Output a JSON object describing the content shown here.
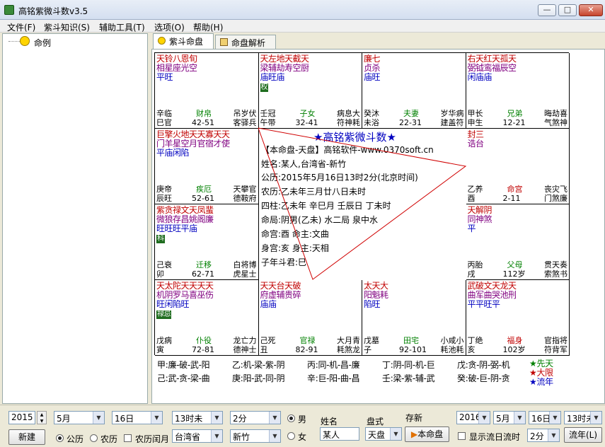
{
  "window": {
    "title": "高铭紫微斗数v3.5",
    "min": "—",
    "max": "□",
    "close": "✕"
  },
  "menu": [
    "文件(F)",
    "紫斗知识(S)",
    "辅助工具(T)",
    "选项(O)",
    "帮助(H)"
  ],
  "tree": {
    "root": "命例"
  },
  "tabs": [
    {
      "label": "紫斗命盘"
    },
    {
      "label": "命盘解析"
    }
  ],
  "palaces": [
    {
      "id": "si",
      "lines": [
        {
          "t": "天铃八恩旬",
          "c": "red"
        },
        {
          "t": "相星座光空",
          "c": "purple"
        },
        {
          "t": "平旺",
          "c": "blue"
        }
      ],
      "hua": "",
      "bl1": "辛临",
      "bl2": "巳官",
      "bc1": "财帛",
      "bc2": "42-51",
      "br1": "吊岁伏",
      "br2": "客驿兵"
    },
    {
      "id": "wu",
      "lines": [
        {
          "t": "天左地天截天",
          "c": "red"
        },
        {
          "t": "梁辅劫寿空厨",
          "c": "purple"
        },
        {
          "t": "庙旺庙",
          "c": "blue"
        }
      ],
      "hua": "权",
      "bl1": "壬冠",
      "bl2": "午带",
      "bc1": "子女",
      "bc2": "32-41",
      "br1": "病息大",
      "br2": "符神耗"
    },
    {
      "id": "wei",
      "lines": [
        {
          "t": "廉七",
          "c": "red"
        },
        {
          "t": "贞杀",
          "c": "purple"
        },
        {
          "t": "庙旺",
          "c": "blue"
        }
      ],
      "hua": "",
      "bl1": "癸沐",
      "bl2": "未浴",
      "bc1": "夫妻",
      "bc2": "22-31",
      "br1": "岁华病",
      "br2": "建盖符"
    },
    {
      "id": "shen",
      "lines": [
        {
          "t": "右天红天孤天",
          "c": "red"
        },
        {
          "t": "弼钺鸾福辰空",
          "c": "purple"
        },
        {
          "t": "闲庙庙",
          "c": "blue"
        }
      ],
      "hua": "",
      "bl1": "甲长",
      "bl2": "申生",
      "bc1": "兄弟",
      "bc2": "12-21",
      "br1": "晦劫喜",
      "br2": "气煞神"
    },
    {
      "id": "chen",
      "lines": [
        {
          "t": "巨擎火地天天寡天天",
          "c": "red"
        },
        {
          "t": "门羊星空月官宿才使",
          "c": "purple"
        },
        {
          "t": "平庙闲陷",
          "c": "blue"
        }
      ],
      "hua": "",
      "bl1": "庚帝",
      "bl2": "辰旺",
      "bc1": "疾厄",
      "bc2": "52-61",
      "br1": "天攀官",
      "br2": "德鞍府"
    },
    {
      "id": "you",
      "lines": [
        {
          "t": "封三",
          "c": "red"
        },
        {
          "t": "诰台",
          "c": "purple"
        }
      ],
      "hua": "",
      "bl1": "乙养",
      "bl2": "酉",
      "bc1": "命宫",
      "bc2": "2-11",
      "br1": "丧灾飞",
      "br2": "门煞廉"
    },
    {
      "id": "mao",
      "lines": [
        {
          "t": "紫贪禄文天凤蜚",
          "c": "red"
        },
        {
          "t": "微狼存昌姚阁廉",
          "c": "purple"
        },
        {
          "t": "旺旺旺平庙",
          "c": "blue"
        }
      ],
      "hua": "科",
      "bl1": "己衰",
      "bl2": "卯",
      "bc1": "迁移",
      "bc2": "62-71",
      "br1": "白将博",
      "br2": "虎星士"
    },
    {
      "id": "xu",
      "lines": [
        {
          "t": "天解阴",
          "c": "red"
        },
        {
          "t": "同神煞",
          "c": "purple"
        },
        {
          "t": "平",
          "c": "blue"
        }
      ],
      "hua": "",
      "bl1": "丙胎",
      "bl2": "戌",
      "bc1": "父母",
      "bc2": "112岁",
      "br1": "贯天奏",
      "br2": "索煞书"
    },
    {
      "id": "yin",
      "lines": [
        {
          "t": "天太陀天天天天",
          "c": "red"
        },
        {
          "t": "机阴罗马喜巫伤",
          "c": "purple"
        },
        {
          "t": "旺闲陷旺",
          "c": "blue"
        }
      ],
      "hua": "禄忌",
      "bl1": "戊病",
      "bl2": "寅",
      "bc1": "仆役",
      "bc2": "72-81",
      "br1": "龙亡力",
      "br2": "德神士"
    },
    {
      "id": "chou",
      "lines": [
        {
          "t": "天天台天破",
          "c": "red"
        },
        {
          "t": "府虚辅贵碎",
          "c": "purple"
        },
        {
          "t": "庙庙",
          "c": "blue"
        }
      ],
      "hua": "",
      "bl1": "己死",
      "bl2": "丑",
      "bc1": "官禄",
      "bc2": "82-91",
      "br1": "大月青",
      "br2": "耗煞龙"
    },
    {
      "id": "zi",
      "lines": [
        {
          "t": "太天大",
          "c": "red"
        },
        {
          "t": "阳魁耗",
          "c": "purple"
        },
        {
          "t": "陷旺",
          "c": "blue"
        }
      ],
      "hua": "",
      "bl1": "戊墓",
      "bl2": "子",
      "bc1": "田宅",
      "bc2": "92-101",
      "br1": "小咸小",
      "br2": "耗池耗"
    },
    {
      "id": "hai",
      "lines": [
        {
          "t": "武破文天龙天",
          "c": "red"
        },
        {
          "t": "曲军曲哭池刑",
          "c": "purple"
        },
        {
          "t": "平平旺平",
          "c": "blue"
        }
      ],
      "hua": "",
      "bl1": "丁绝",
      "bl2": "亥",
      "bc1": "福身",
      "bc2": "102岁",
      "br1": "官指将",
      "br2": "符背军"
    }
  ],
  "center": {
    "title": "★高铭紫微斗数★",
    "lines": [
      "【本命盘-天盘】高铭软件-www.0370soft.cn",
      "姓名:某人,台湾省-新竹",
      "公历:2015年5月16日13时2分(北京时间)",
      "农历:乙未年三月廿八日未时",
      "四柱:乙未年  辛巳月  壬辰日  丁未时",
      "命局:阴男(乙未)  水二局  泉中水",
      "命宫:酉          命主:文曲",
      "身宫:亥          身主:天相",
      "子年斗君:巳"
    ]
  },
  "legend": {
    "row1": [
      "甲:廉-破-武-阳",
      "乙:机-梁-紫-阴",
      "丙:同-机-昌-廉",
      "丁:阴-同-机-巨",
      "戊:贪-阴-弼-机"
    ],
    "row2": [
      "己:武-贪-梁-曲",
      "庚:阳-武-同-阴",
      "辛:巨-阳-曲-昌",
      "壬:梁-紫-辅-武",
      "癸:破-巨-阴-贪"
    ],
    "stars": [
      {
        "t": "★先天",
        "c": "#008000"
      },
      {
        "t": "★大限",
        "c": "#c00000"
      },
      {
        "t": "★流年",
        "c": "#0000c0"
      }
    ]
  },
  "controls": {
    "year": "2015",
    "month": "5月",
    "day": "16日",
    "hour": "13时未",
    "minute": "2分",
    "male": "男",
    "female": "女",
    "name_label": "姓名",
    "name_value": "某人",
    "style_label": "盘式",
    "style_value": "天盘",
    "save_label": "存新",
    "chart_btn": "本命盘",
    "new_btn": "新建",
    "solar": "公历",
    "lunar": "农历",
    "leap": "农历闰月",
    "province": "台湾省",
    "city": "新竹",
    "r_year": "2016",
    "r_month": "5月",
    "r_day": "16日",
    "r_hour": "13时未",
    "r_minute": "2分",
    "show_flow": "显示流日流时",
    "flow_btn": "流年(L)"
  }
}
